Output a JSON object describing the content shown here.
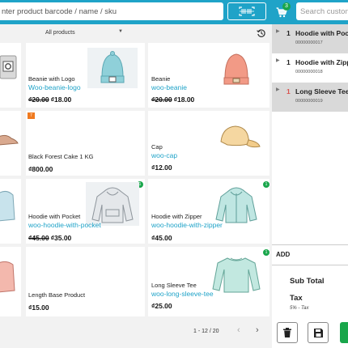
{
  "topbar": {
    "search_placeholder": "nter product barcode / name / sku",
    "cart_count": "3",
    "customer_placeholder": "Search custom"
  },
  "filter": {
    "category": "All products"
  },
  "products": [
    {
      "name": "",
      "slug": "",
      "price_old": "",
      "price": ""
    },
    {
      "name": "Beanie with Logo",
      "slug": "Woo-beanie-logo",
      "price_old": "₫20.00",
      "price": "₫18.00"
    },
    {
      "name": "Beanie",
      "slug": "woo-beanie",
      "price_old": "₫20.00",
      "price": "₫18.00"
    },
    {
      "name": "",
      "slug": "",
      "price_old": "",
      "price": ""
    },
    {
      "name": "Black Forest Cake 1 KG",
      "slug": "",
      "price_old": "",
      "price": "₫800.00",
      "badge": "7"
    },
    {
      "name": "Cap",
      "slug": "woo-cap",
      "price_old": "",
      "price": "₫12.00"
    },
    {
      "name": "",
      "slug": "",
      "price_old": "",
      "price": ""
    },
    {
      "name": "Hoodie with Pocket",
      "slug": "woo-hoodie-with-pocket",
      "price_old": "₫45.00",
      "price": "₫35.00",
      "badge": "1"
    },
    {
      "name": "Hoodie with Zipper",
      "slug": "woo-hoodie-with-zipper",
      "price_old": "",
      "price": "₫45.00",
      "badge": "1"
    },
    {
      "name": "",
      "slug": "",
      "price_old": "",
      "price": ""
    },
    {
      "name": "Length Base Product",
      "slug": "",
      "price_old": "",
      "price": "₫15.00"
    },
    {
      "name": "Long Sleeve Tee",
      "slug": "woo-long-sleeve-tee",
      "price_old": "",
      "price": "₫25.00",
      "badge": "1"
    }
  ],
  "pagination": {
    "info": "1 - 12 / 20",
    "prev": "‹",
    "next": "›"
  },
  "cart": {
    "items": [
      {
        "qty": "1",
        "title": "Hoodie with Pocket",
        "sku": "00000000017"
      },
      {
        "qty": "1",
        "title": "Hoodie with Zipper",
        "sku": "00000000018"
      },
      {
        "qty": "1",
        "title": "Long Sleeve Tee",
        "sku": "00000000019"
      }
    ],
    "add_label": "ADD",
    "subtotal_label": "Sub Total",
    "tax_label": "Tax",
    "tax_sub": "5% - Tax"
  },
  "colors": {
    "accent": "#1fa3c8",
    "badge_green": "#19a64b",
    "badge_orange": "#f07a1f",
    "selected_row": "#d9d9d9",
    "qty_red": "#d9534f"
  }
}
